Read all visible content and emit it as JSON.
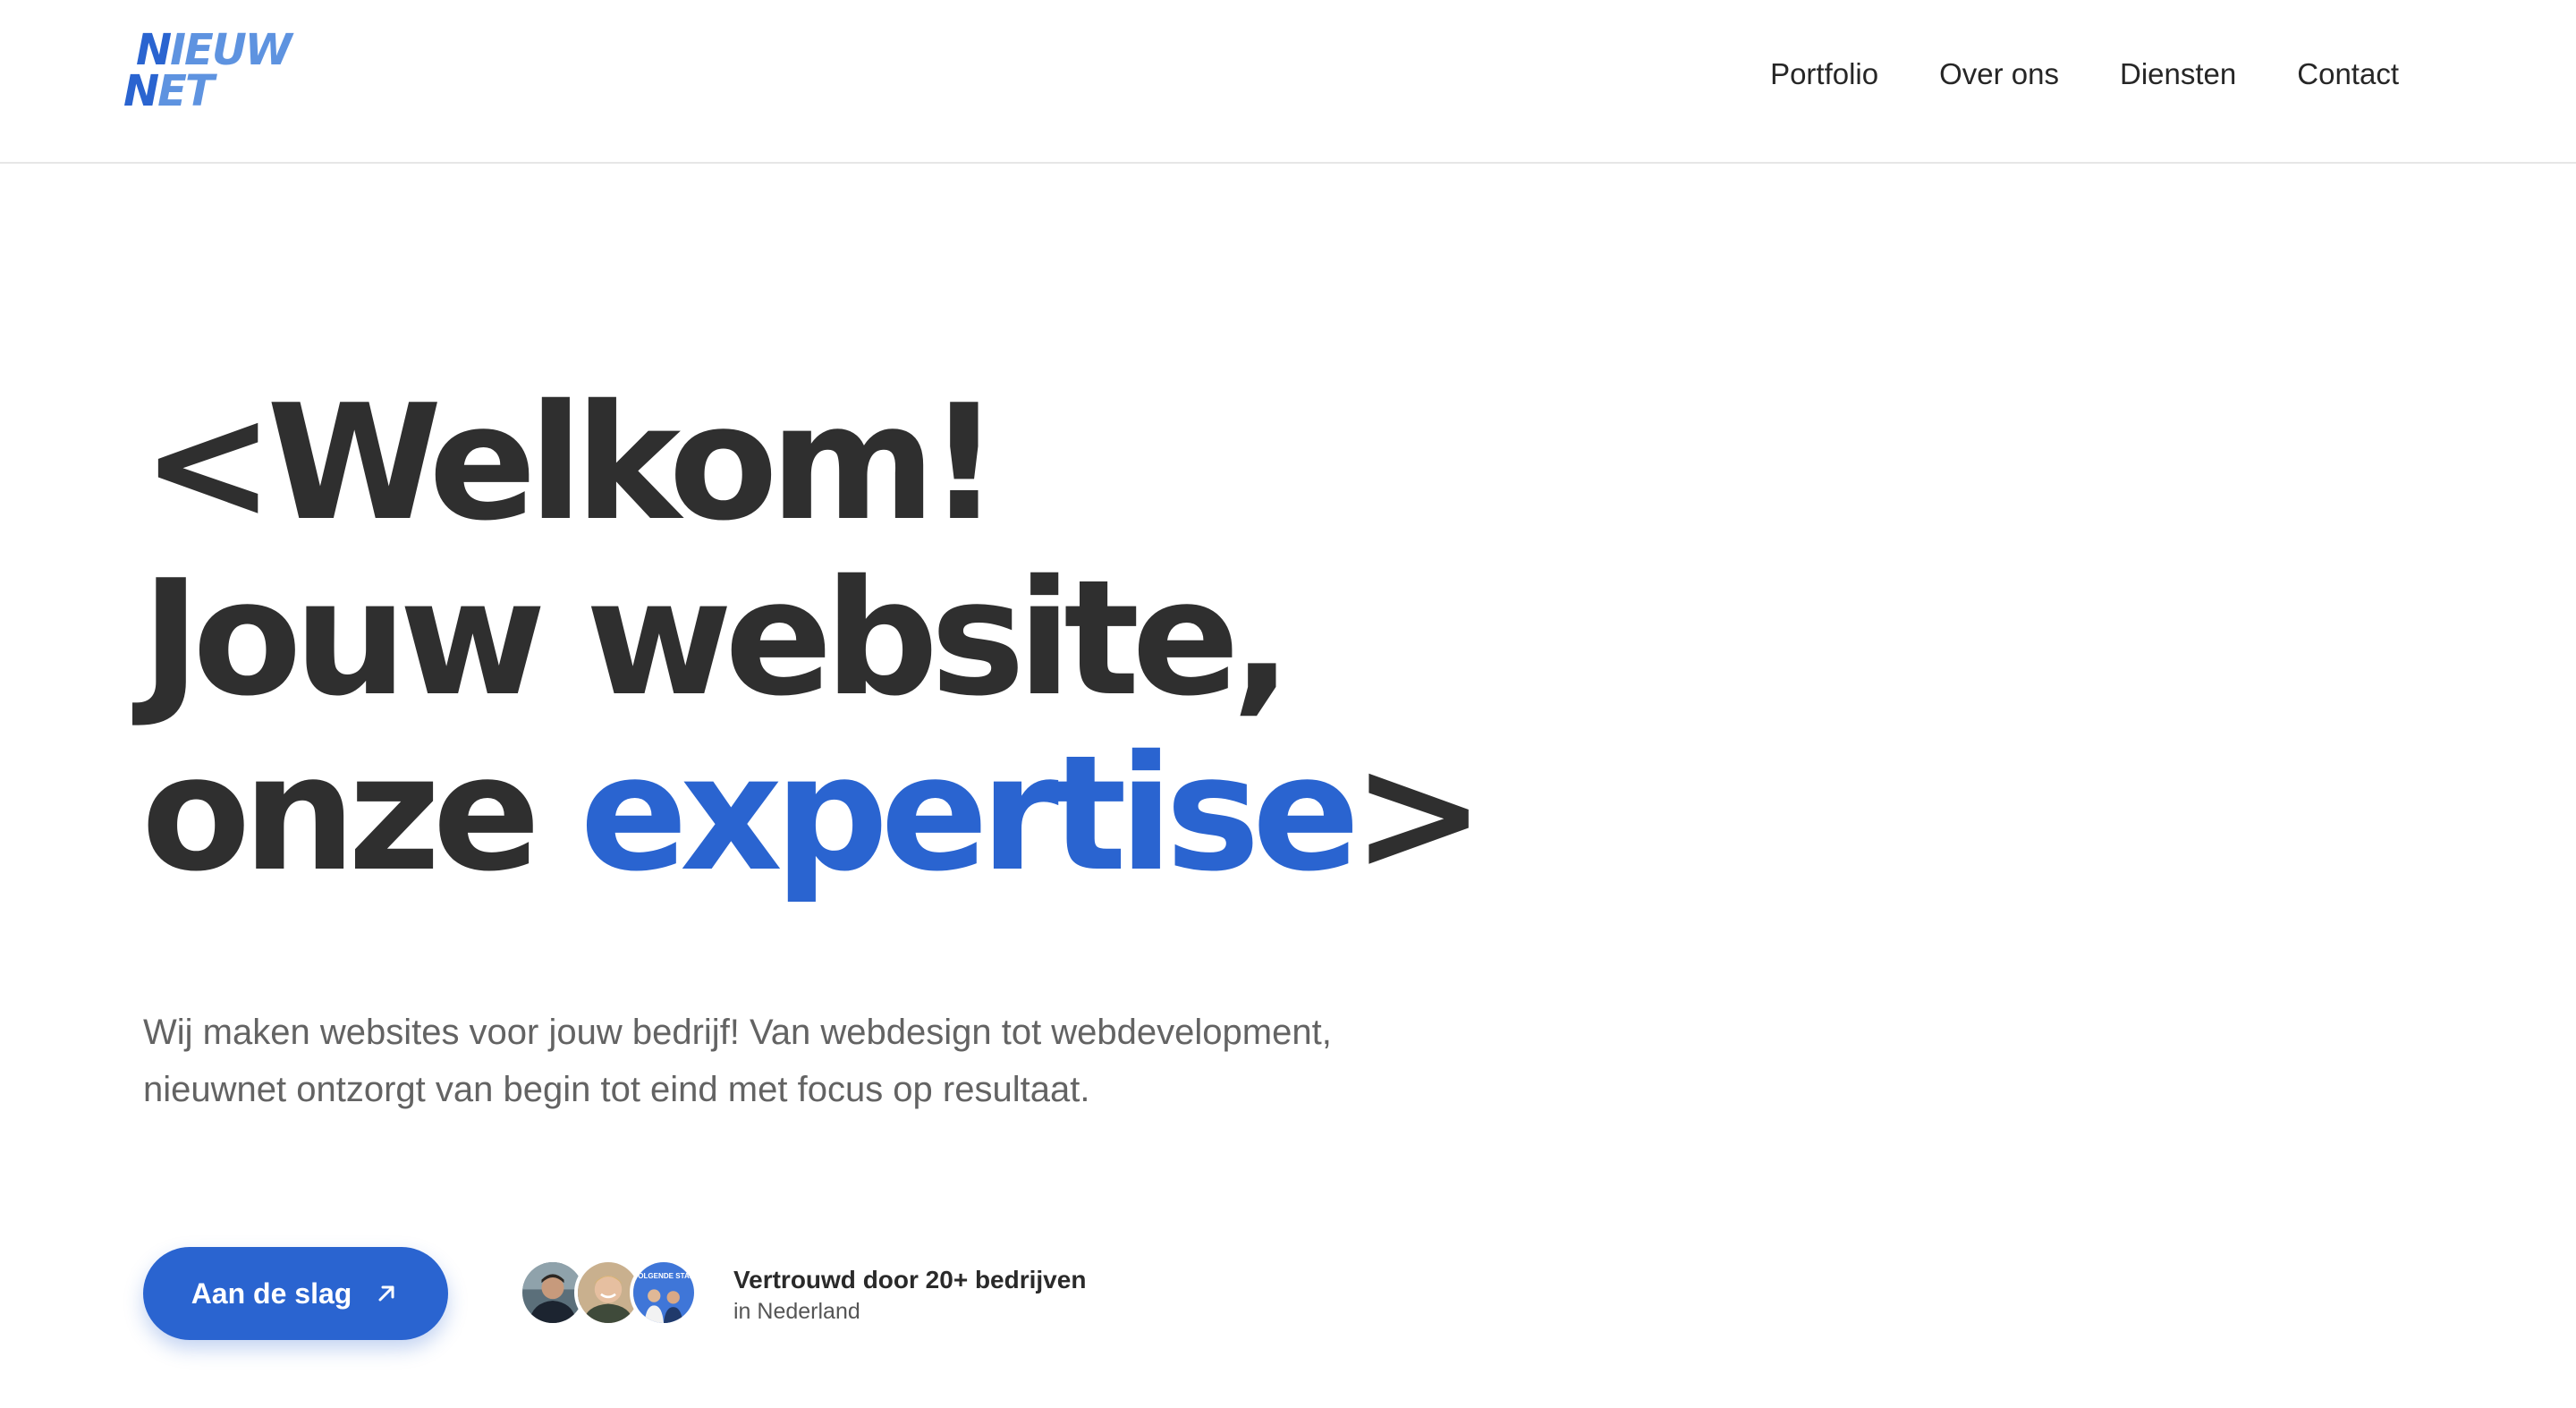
{
  "header": {
    "logo": {
      "line1_first": "N",
      "line1_rest": "IEUW",
      "line2_first": "N",
      "line2_rest": "ET"
    },
    "nav": [
      "Portfolio",
      "Over ons",
      "Diensten",
      "Contact"
    ]
  },
  "hero": {
    "title_line1": "<Welkom!",
    "title_line2": "Jouw website,",
    "title_line3_plain": "onze ",
    "title_line3_accent": "expertise",
    "title_line3_end": ">",
    "subtitle": "Wij maken websites voor jouw bedrijf! Van webdesign tot webdevelopment, nieuwnet ontzorgt van begin tot eind met focus op resultaat.",
    "cta_label": "Aan de slag",
    "trust_title": "Vertrouwd door 20+ bedrijven",
    "trust_sub": "in Nederland",
    "avatar_badge_text": "VOLGENDE STAP"
  },
  "colors": {
    "accent": "#2a64d0",
    "accent_light": "#5e93e0",
    "heading": "#2f2f2f",
    "body_text": "#636363"
  },
  "icons": [
    "arrow-up-right-icon"
  ]
}
